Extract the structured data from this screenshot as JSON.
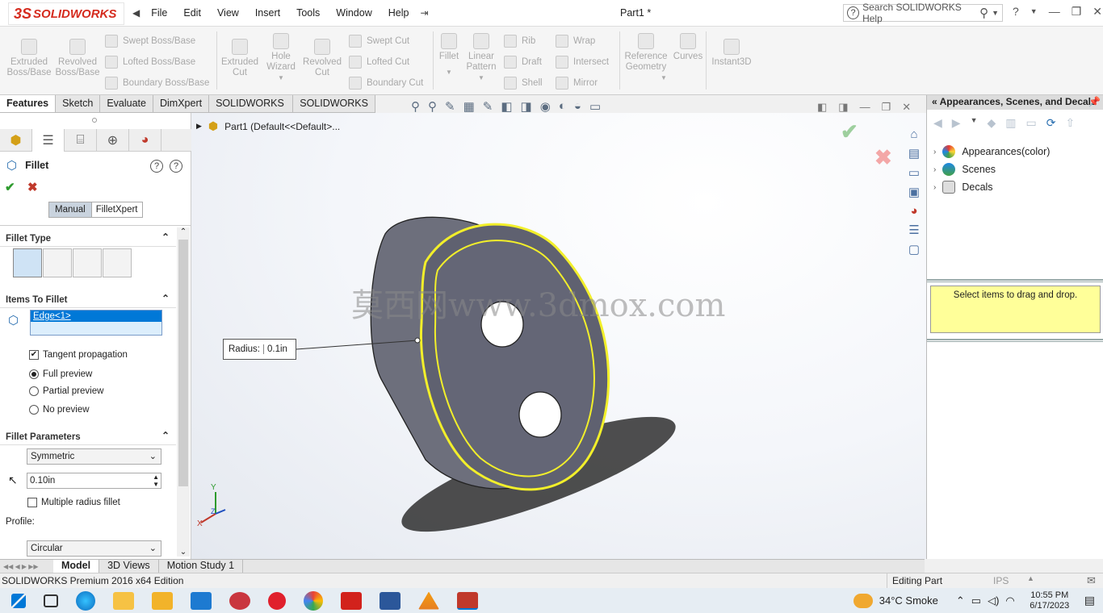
{
  "app": {
    "brand_ds": "3S",
    "brand_name": "SOLIDWORKS",
    "doc_title": "Part1 *"
  },
  "menu": [
    "File",
    "Edit",
    "View",
    "Insert",
    "Tools",
    "Window",
    "Help"
  ],
  "search": {
    "placeholder": "Search SOLIDWORKS Help"
  },
  "toolbar": {
    "extruded_boss": "Extruded Boss/Base",
    "revolved_boss": "Revolved Boss/Base",
    "swept_boss": "Swept Boss/Base",
    "lofted_boss": "Lofted Boss/Base",
    "boundary_boss": "Boundary Boss/Base",
    "extruded_cut": "Extruded Cut",
    "hole_wizard": "Hole Wizard",
    "revolved_cut": "Revolved Cut",
    "swept_cut": "Swept Cut",
    "lofted_cut": "Lofted Cut",
    "boundary_cut": "Boundary Cut",
    "fillet": "Fillet",
    "linear_pattern": "Linear Pattern",
    "rib": "Rib",
    "draft": "Draft",
    "shell": "Shell",
    "wrap": "Wrap",
    "intersect": "Intersect",
    "mirror": "Mirror",
    "ref_geom": "Reference Geometry",
    "curves": "Curves",
    "instant3d": "Instant3D"
  },
  "tabs": [
    "Features",
    "Sketch",
    "Evaluate",
    "DimXpert",
    "SOLIDWORKS Add-Ins",
    "SOLIDWORKS MBD"
  ],
  "tree_root": "Part1  (Default<<Default>...",
  "fillet": {
    "title": "Fillet",
    "mode_manual": "Manual",
    "mode_xpert": "FilletXpert",
    "fillet_type": "Fillet Type",
    "items_to_fillet": "Items To Fillet",
    "edge": "Edge<1>",
    "tangent": "Tangent propagation",
    "full_preview": "Full preview",
    "partial_preview": "Partial preview",
    "no_preview": "No preview",
    "params": "Fillet Parameters",
    "symmetric": "Symmetric",
    "radius_value": "0.10in",
    "multiple_radius": "Multiple radius fillet",
    "profile_label": "Profile:",
    "profile_value": "Circular"
  },
  "callout": {
    "label": "Radius:",
    "value": "0.1in"
  },
  "watermark": "莫西网www.3dmox.com",
  "triad": {
    "y": "Y",
    "x": "X",
    "z": "Z"
  },
  "right_panel": {
    "title": "Appearances, Scenes, and Decals",
    "items": [
      "Appearances(color)",
      "Scenes",
      "Decals"
    ],
    "hint": "Select items to drag and drop."
  },
  "bottom_tabs": [
    "Model",
    "3D Views",
    "Motion Study 1"
  ],
  "status": {
    "edition": "SOLIDWORKS Premium 2016 x64 Edition",
    "mode": "Editing Part",
    "units": "IPS"
  },
  "taskbar": {
    "weather": "34°C  Smoke",
    "time": "10:55 PM",
    "date": "6/17/2023"
  },
  "colors": {
    "accent": "#d52b1e",
    "select_blue": "#0078d7",
    "edge_yellow": "#f2ef2a",
    "hint_yellow": "#ffff99"
  }
}
